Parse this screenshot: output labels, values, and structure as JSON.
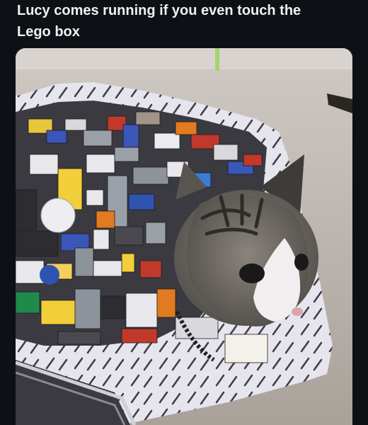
{
  "post": {
    "caption": "Lucy comes running if you even touch the\nLego box"
  },
  "media": {
    "icon": "photo-icon",
    "colors": {
      "carpet": "#b9b2ab",
      "basket": "#e8e6ee",
      "cat_tabby": "#6f6a64",
      "cat_white": "#f1eeef",
      "background": "#0d1014",
      "caption_text": "#eef0f2"
    }
  }
}
